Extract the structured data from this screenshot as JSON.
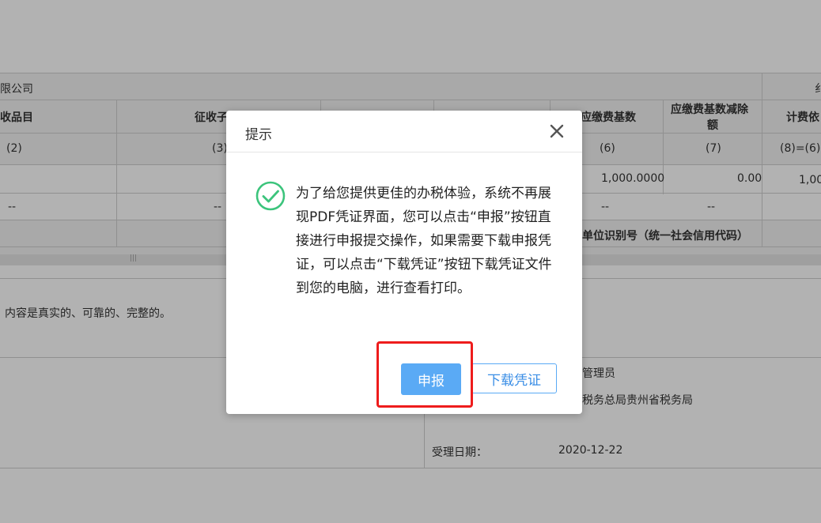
{
  "background": {
    "company_partial": "限公司",
    "right_header_partial": "纟",
    "columns": {
      "col_a": "收品目",
      "col_b": "征收子",
      "col_c": "应缴费基数",
      "col_d_line1": "应缴费基数减除",
      "col_d_line2": "额",
      "col_e": "计费依"
    },
    "indices": {
      "i2": "(2)",
      "i3": "(3)",
      "i6": "(6)",
      "i7": "(7)",
      "i8": "(8)=(6)"
    },
    "row_values": {
      "base_amount": "1,000.0000",
      "deduction": "0.00",
      "partial": "1,00"
    },
    "dashes": "--",
    "unit_id_label": "单位识别号（统一社会信用代码）",
    "scroll_marker": "|||",
    "declaration_partial": "内容是真实的、可靠的、完整的。",
    "admin_label": "管理员",
    "tax_bureau": "税务总局贵州省税务局",
    "accept_date_label": "受理日期：",
    "accept_date_value": "2020-12-22"
  },
  "dialog": {
    "title": "提示",
    "close_icon": "close-icon",
    "status_icon": "check-circle-icon",
    "message": "为了给您提供更佳的办税体验，系统不再展现PDF凭证界面，您可以点击“申报”按钮直接进行申报提交操作，如果需要下载申报凭证，可以点击“下载凭证”按钮下载凭证文件到您的电脑，进行查看打印。",
    "primary_button": "申报",
    "secondary_button": "下载凭证"
  },
  "colors": {
    "primary": "#5aaaf5",
    "success": "#3cc47c",
    "highlight": "#ee1c1c"
  }
}
